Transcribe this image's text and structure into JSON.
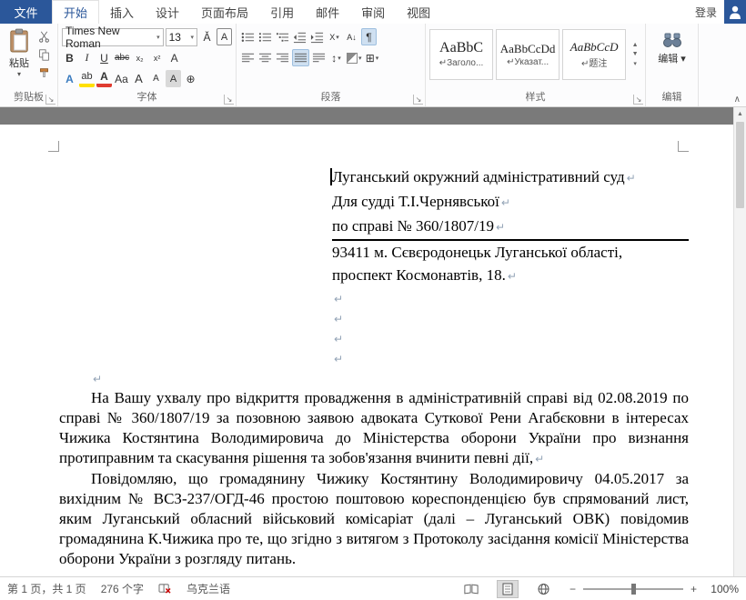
{
  "tabs": {
    "file": "文件",
    "items": [
      "开始",
      "插入",
      "设计",
      "页面布局",
      "引用",
      "邮件",
      "审阅",
      "视图"
    ],
    "sign_in": "登录"
  },
  "ribbon": {
    "groups": {
      "clipboard": "剪贴板",
      "font": "字体",
      "paragraph": "段落",
      "styles": "样式",
      "editing": "编辑"
    },
    "clipboard": {
      "paste": "粘贴"
    },
    "font": {
      "name": "Times New Roman",
      "size": "13"
    },
    "styles": [
      {
        "preview": "AaBbC",
        "name": "↵Заголо..."
      },
      {
        "preview": "AaBbCcDd",
        "name": "↵Указат..."
      },
      {
        "preview": "AaBbCcD",
        "name": "↵题注"
      }
    ],
    "editing_label": "编辑"
  },
  "icons": {
    "bold": "B",
    "italic": "I",
    "underline": "U",
    "strikethrough": "abc",
    "subscript": "x₂",
    "superscript": "x²",
    "clear_format": "A",
    "text_effects": "A",
    "highlight": "ab",
    "font_color": "A",
    "change_case": "Aa",
    "grow_font": "A",
    "shrink_font": "A",
    "char_shading": "A",
    "enclose_char": "⊕",
    "char_border": "A",
    "phonetic": "Ǎ",
    "show_marks": "¶",
    "borders": "⊞",
    "sort": "A↓",
    "line_spacing": "↕",
    "asian_layout": "X",
    "dropdown": "▾",
    "collapse": "∧",
    "scroll_up": "▲",
    "minus": "−",
    "plus": "+"
  },
  "document": {
    "address": [
      "Луганський окружний адміністративний суд",
      "Для судді Т.І.Чернявської",
      "по справі № 360/1807/19",
      "93411 м. Сєвєродонецьк Луганської області,",
      "проспект Космонавтів, 18."
    ],
    "paragraphs": [
      "На Вашу ухвалу про відкриття провадження в адміністративній справі від 02.08.2019 по справі № 360/1807/19 за позовною заявою адвоката Суткової Рени Агабєковни в інтересах Чижика Костянтина Володимировича до Міністерства оборони України про визнання протиправним та скасування рішення та зобов'язання вчинити певні дії,",
      "Повідомляю, що громадянину Чижику Костянтину Володимировичу 04.05.2017 за вихідним № ВСЗ-237/ОГД-46 простою поштовою кореспонденцією був спрямований лист, яким Луганський обласний військовий комісаріат (далі – Луганський ОВК) повідомив громадянина К.Чижика про те, що згідно з витягом з Протоколу засідання комісії Міністерства оборони України з розгляду питань."
    ]
  },
  "statusbar": {
    "page": "第 1 页，共 1 页",
    "words": "276 个字",
    "language": "乌克兰语",
    "zoom": "100%"
  }
}
